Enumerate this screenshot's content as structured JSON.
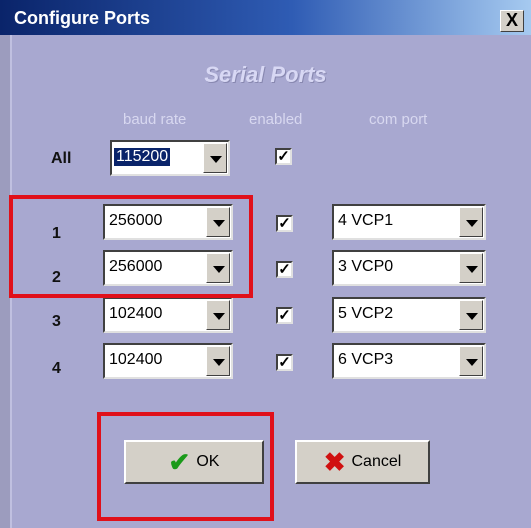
{
  "window": {
    "title": "Configure Ports",
    "close_glyph": "X"
  },
  "section_title": "Serial Ports",
  "columns": {
    "baud": "baud rate",
    "enabled": "enabled",
    "com": "com port"
  },
  "rows": [
    {
      "label": "All",
      "baud": "115200",
      "enabled": true
    },
    {
      "label": "1",
      "baud": "256000",
      "enabled": true,
      "com": "4 VCP1"
    },
    {
      "label": "2",
      "baud": "256000",
      "enabled": true,
      "com": "3 VCP0"
    },
    {
      "label": "3",
      "baud": "102400",
      "enabled": true,
      "com": "5 VCP2"
    },
    {
      "label": "4",
      "baud": "102400",
      "enabled": true,
      "com": "6 VCP3"
    }
  ],
  "buttons": {
    "ok": "OK",
    "cancel": "Cancel"
  },
  "icons": {
    "ok": "checkmark-icon",
    "cancel": "x-icon",
    "dropdown": "dropdown-arrow-icon"
  },
  "colors": {
    "highlight_box": "#e0101a",
    "ok_icon": "#1a9a1a",
    "cancel_icon": "#d01010"
  }
}
